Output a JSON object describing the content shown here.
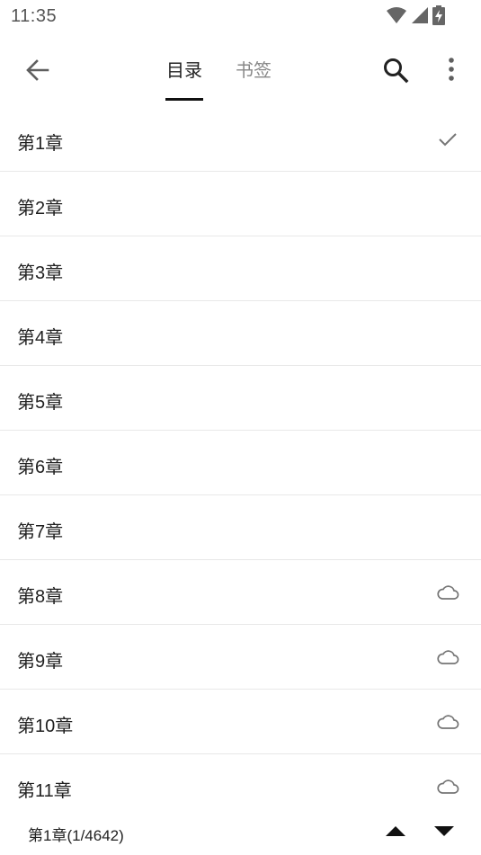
{
  "status_bar": {
    "time": "11:35",
    "icons": [
      "wifi-icon",
      "signal-icon",
      "battery-charging-icon"
    ]
  },
  "toolbar": {
    "back_icon": "arrow-left-icon",
    "tabs": [
      {
        "label": "目录",
        "selected": true
      },
      {
        "label": "书签",
        "selected": false
      }
    ],
    "search_icon": "search-icon",
    "more_icon": "more-vertical-icon"
  },
  "chapters": [
    {
      "title": "第1章",
      "status": "current"
    },
    {
      "title": "第2章",
      "status": "none"
    },
    {
      "title": "第3章",
      "status": "none"
    },
    {
      "title": "第4章",
      "status": "none"
    },
    {
      "title": "第5章",
      "status": "none"
    },
    {
      "title": "第6章",
      "status": "none"
    },
    {
      "title": "第7章",
      "status": "none"
    },
    {
      "title": "第8章",
      "status": "cloud"
    },
    {
      "title": "第9章",
      "status": "cloud"
    },
    {
      "title": "第10章",
      "status": "cloud"
    },
    {
      "title": "第11章",
      "status": "cloud"
    }
  ],
  "bottom_bar": {
    "progress": "第1章(1/4642)",
    "up_icon": "triangle-up-icon",
    "down_icon": "triangle-down-icon"
  },
  "colors": {
    "text": "#212121",
    "muted": "#888888",
    "divider": "#e8e8e8",
    "icon": "#757575"
  }
}
